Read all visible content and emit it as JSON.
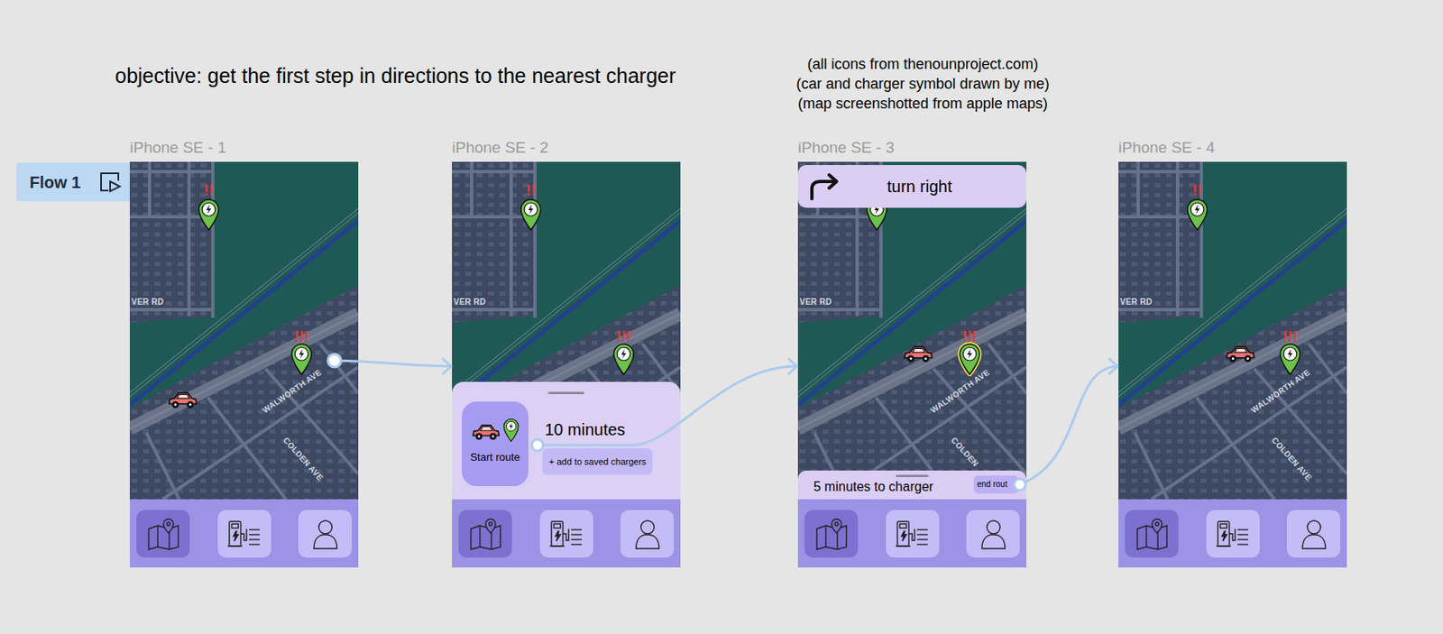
{
  "objective": "objective: get the first step in directions to the nearest charger",
  "notes": [
    "(all icons from thenounproject.com)",
    "(car and charger symbol drawn by me)",
    "(map screenshotted from apple maps)"
  ],
  "flow": {
    "label": "Flow 1"
  },
  "frames": [
    {
      "title": "iPhone SE - 1",
      "map_labels": [
        "VER RD",
        "WALWORTH AVE",
        "COLDEN AVE"
      ],
      "chargers": [
        {
          "badge": "!!",
          "highlighted": false
        },
        {
          "badge": "!!!",
          "highlighted": false
        }
      ],
      "nav": [
        {
          "selected": true
        },
        {
          "selected": false
        },
        {
          "selected": false
        }
      ]
    },
    {
      "title": "iPhone SE - 2",
      "map_labels": [
        "VER RD"
      ],
      "chargers": [
        {
          "badge": "!!",
          "highlighted": false
        },
        {
          "badge": "!!!",
          "highlighted": false
        }
      ],
      "sheet": {
        "start_label": "Start route",
        "duration": "10 minutes",
        "save_button": "+ add to saved chargers"
      },
      "nav": [
        {
          "selected": true
        },
        {
          "selected": false
        },
        {
          "selected": false
        }
      ]
    },
    {
      "title": "iPhone SE - 3",
      "map_labels": [
        "VER RD",
        "WALWORTH AVE",
        "COLDEN"
      ],
      "chargers": [
        {
          "highlighted": false
        },
        {
          "badge": "!!!",
          "highlighted": true
        }
      ],
      "banner": {
        "instruction": "turn right"
      },
      "status": {
        "text": "5 minutes to charger",
        "end_button": "end rout"
      },
      "nav": [
        {
          "selected": true
        },
        {
          "selected": false
        },
        {
          "selected": false
        }
      ]
    },
    {
      "title": "iPhone SE - 4",
      "map_labels": [
        "VER RD",
        "WALWORTH AVE",
        "COLDEN AVE"
      ],
      "chargers": [
        {
          "badge": "!!",
          "highlighted": false
        },
        {
          "badge": "!!!",
          "highlighted": false
        }
      ],
      "nav": [
        {
          "selected": true
        },
        {
          "selected": false
        },
        {
          "selected": false
        }
      ]
    }
  ]
}
